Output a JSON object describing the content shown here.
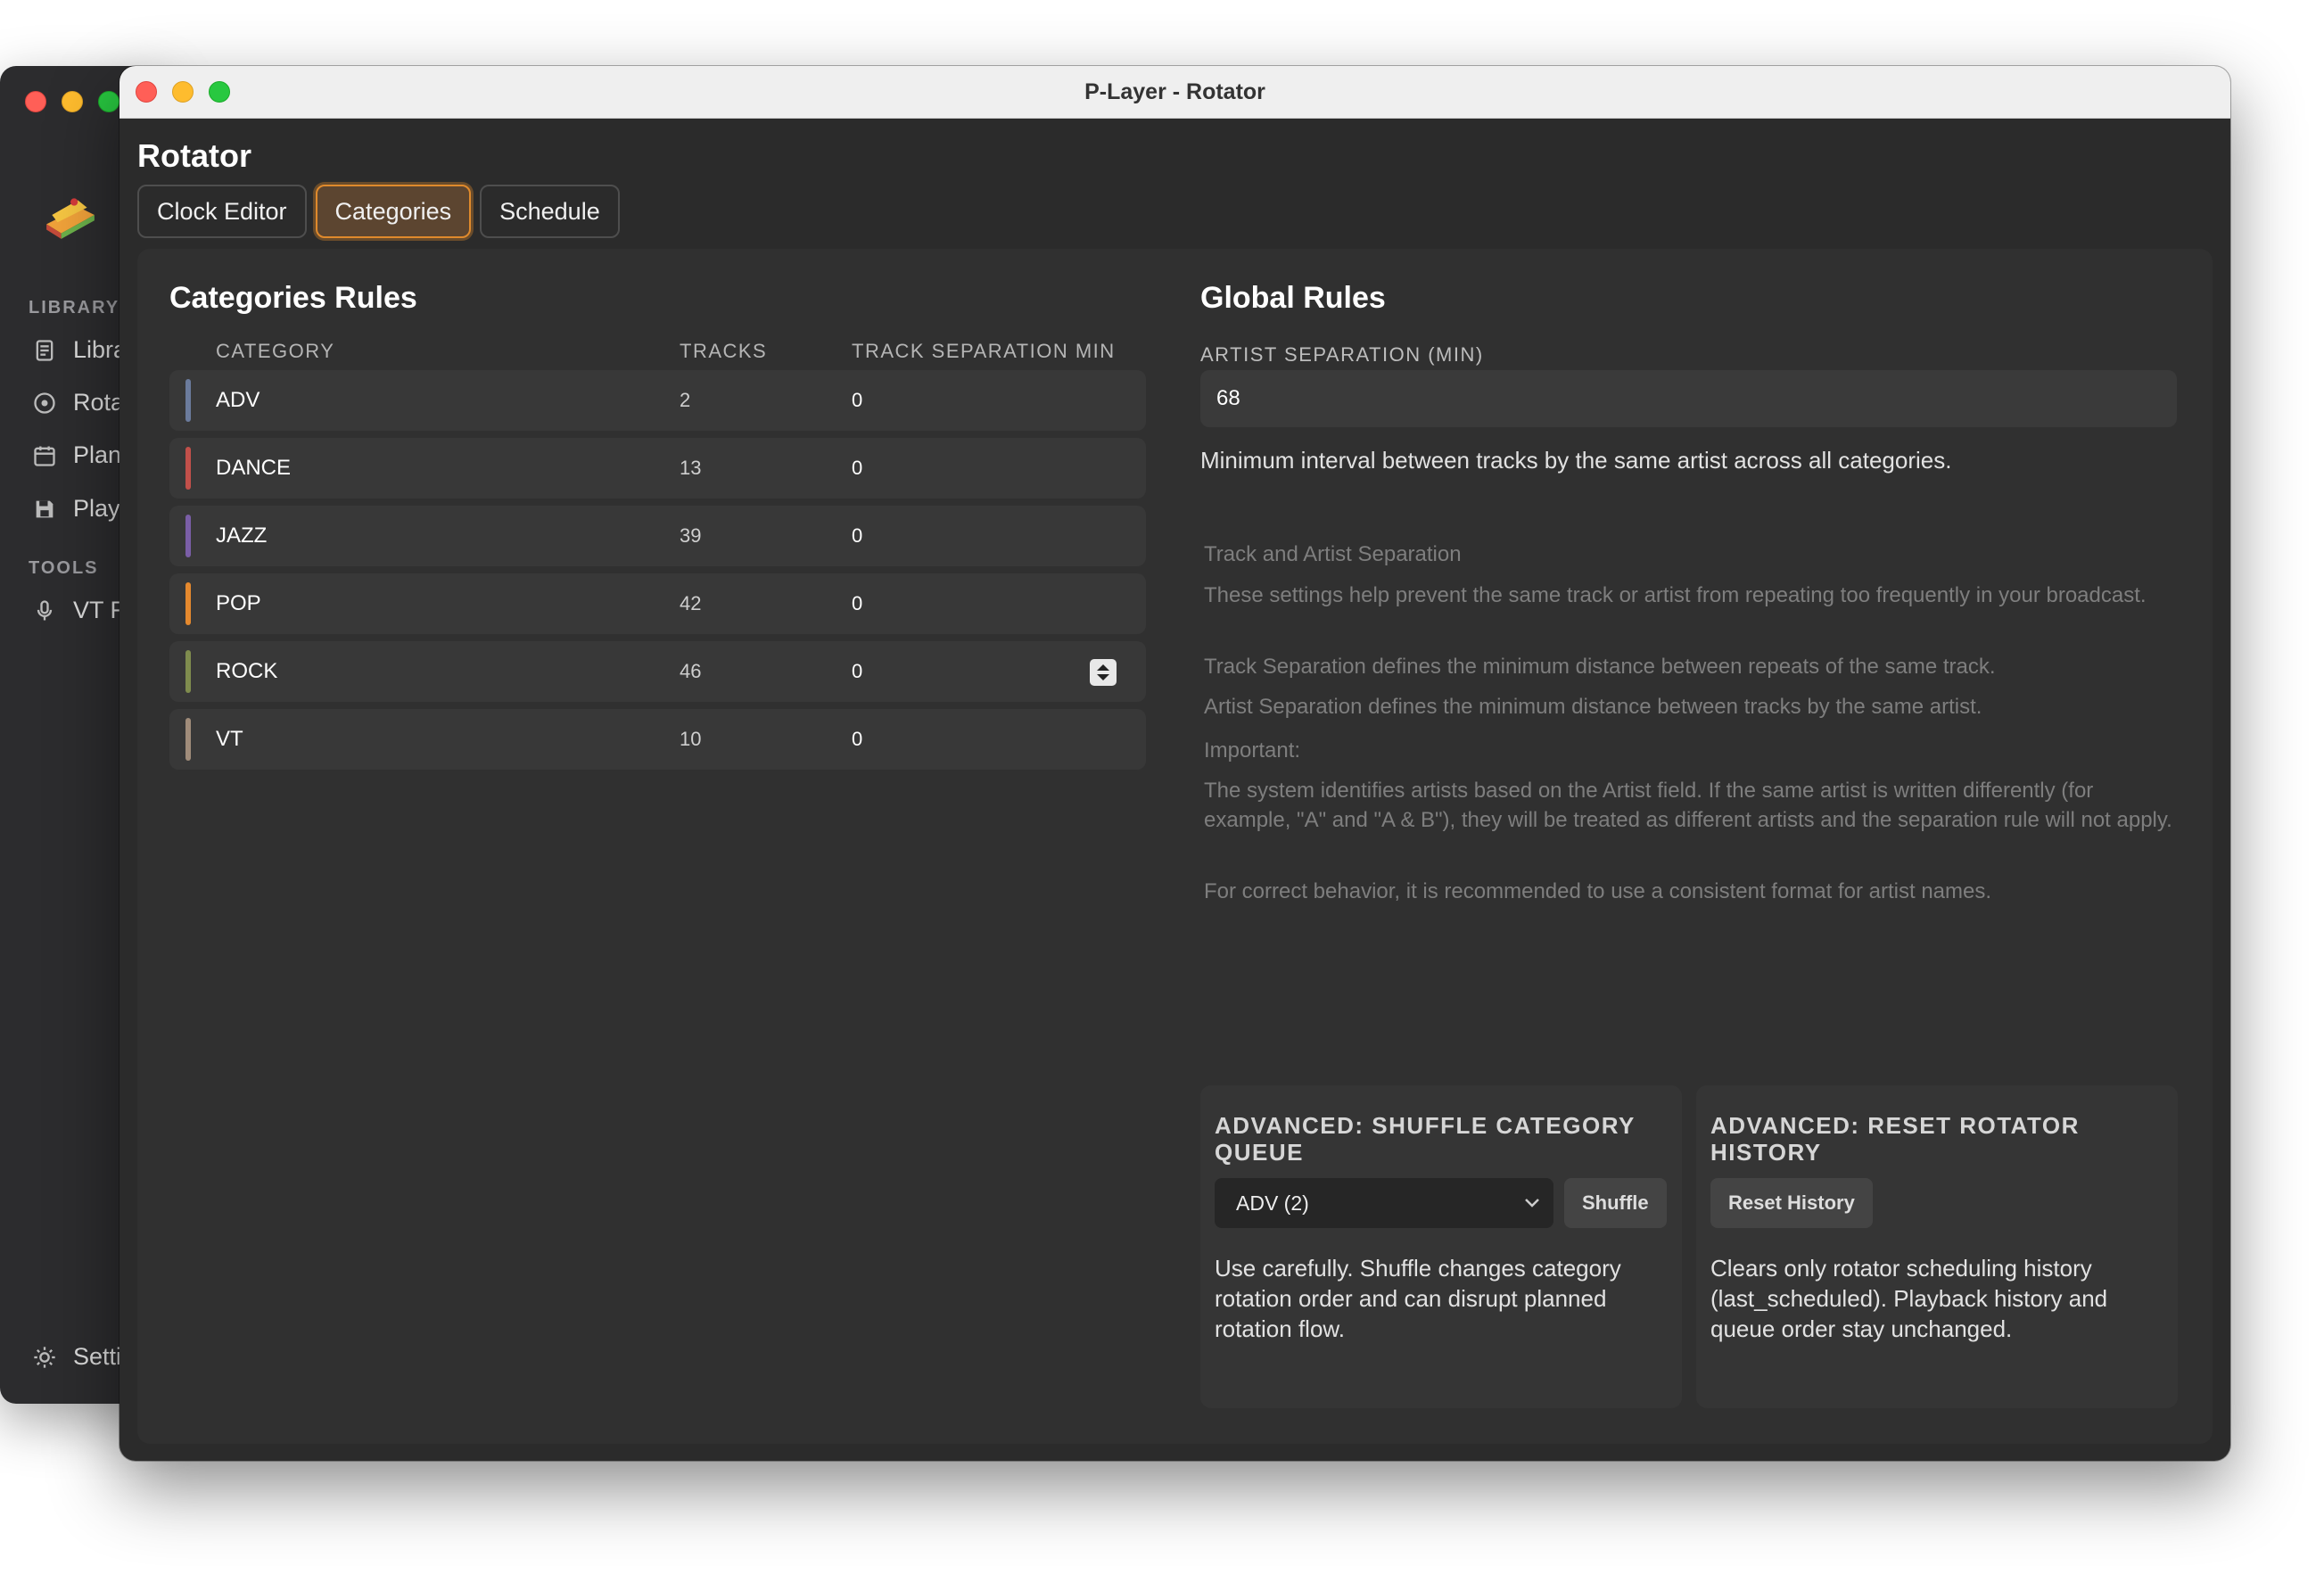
{
  "window": {
    "title": "P-Layer - Rotator"
  },
  "sidebar": {
    "library_heading": "LIBRARY",
    "tools_heading": "TOOLS",
    "items": [
      {
        "label": "Libra",
        "icon": "document-icon"
      },
      {
        "label": "Rota",
        "icon": "target-icon"
      },
      {
        "label": "Plan",
        "icon": "calendar-icon"
      },
      {
        "label": "Play",
        "icon": "save-icon"
      }
    ],
    "tools": [
      {
        "label": "VT F",
        "icon": "microphone-icon"
      }
    ],
    "settings": {
      "label": "Setti",
      "icon": "gear-icon"
    }
  },
  "page": {
    "heading": "Rotator",
    "tabs": [
      {
        "label": "Clock Editor",
        "active": false
      },
      {
        "label": "Categories",
        "active": true
      },
      {
        "label": "Schedule",
        "active": false
      }
    ]
  },
  "categories": {
    "title": "Categories Rules",
    "columns": {
      "category": "CATEGORY",
      "tracks": "TRACKS",
      "separation": "TRACK SEPARATION MIN"
    },
    "rows": [
      {
        "name": "ADV",
        "tracks": "2",
        "sep": "0",
        "color": "#6b7b9c"
      },
      {
        "name": "DANCE",
        "tracks": "13",
        "sep": "0",
        "color": "#c2504a"
      },
      {
        "name": "JAZZ",
        "tracks": "39",
        "sep": "0",
        "color": "#7a5ea6"
      },
      {
        "name": "POP",
        "tracks": "42",
        "sep": "0",
        "color": "#e5892e"
      },
      {
        "name": "ROCK",
        "tracks": "46",
        "sep": "0",
        "color": "#7f8c4e"
      },
      {
        "name": "VT",
        "tracks": "10",
        "sep": "0",
        "color": "#a08c7a"
      }
    ]
  },
  "global": {
    "title": "Global Rules",
    "artist_label": "ARTIST SEPARATION (MIN)",
    "artist_value": "68",
    "artist_desc": "Minimum interval between tracks by the same artist across all categories.",
    "help": [
      "Track and Artist Separation",
      "These settings help prevent the same track or artist from repeating too frequently in your broadcast.",
      "Track Separation defines the minimum distance between repeats of the same track.",
      "Artist Separation defines the minimum distance between tracks by the same artist.",
      "Important:",
      "The system identifies artists based on the Artist field. If the same artist is written differently (for example, \"A\" and \"A & B\"), they will be treated as different artists and the separation rule will not apply.",
      "For correct behavior, it is recommended to use a consistent format for artist names."
    ]
  },
  "advanced": {
    "shuffle": {
      "title": "ADVANCED: SHUFFLE CATEGORY QUEUE",
      "select_value": "ADV (2)",
      "button": "Shuffle",
      "desc": "Use carefully. Shuffle changes category rotation order and can disrupt planned rotation flow."
    },
    "reset": {
      "title": "ADVANCED: RESET ROTATOR HISTORY",
      "button": "Reset History",
      "desc": "Clears only rotator scheduling history (last_scheduled). Playback history and queue order stay unchanged."
    }
  }
}
